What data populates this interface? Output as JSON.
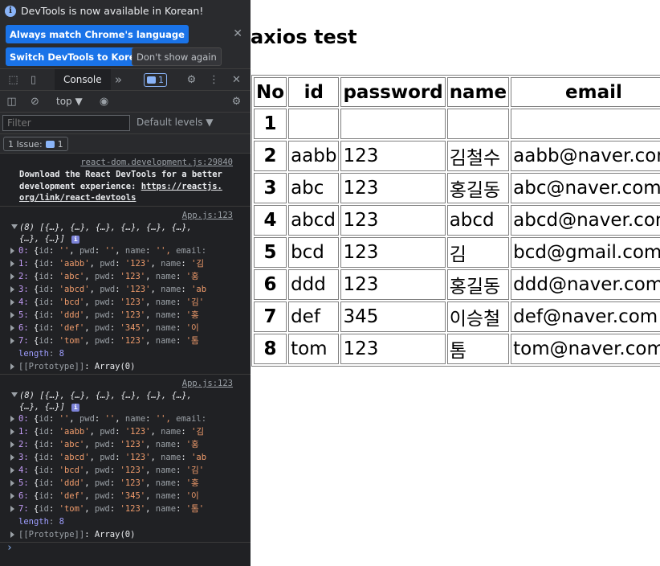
{
  "devtools": {
    "infobar": {
      "message": "DevTools is now available in Korean!",
      "btn_match": "Always match Chrome's language",
      "btn_switch": "Switch DevTools to Korean",
      "btn_dont": "Don't show again"
    },
    "tabs": {
      "console": "Console",
      "more": "»",
      "issues_count": "1"
    },
    "toolbar": {
      "context": "top ▼",
      "filter_placeholder": "Filter",
      "levels": "Default levels ▼",
      "issue_chip_label": "1 Issue:",
      "issue_chip_count": "1"
    },
    "log1": {
      "source": "react-dom.development.js:29840",
      "line1": "Download the React DevTools for a better",
      "line2_prefix": "development experience: ",
      "link_part1": "https://reactjs.",
      "link_part2": "org/link/react-devtools"
    },
    "log2": {
      "source": "App.js:123",
      "summary_1": "(8) [{…}, {…}, {…}, {…}, {…}, {…},",
      "summary_2": "{…}, {…}]",
      "rows": [
        {
          "idx": "0:",
          "id": "''",
          "pwd": "''",
          "name": "'',",
          "tail": "email:"
        },
        {
          "idx": "1:",
          "id": "'aabb'",
          "pwd": "'123'",
          "name": "'김"
        },
        {
          "idx": "2:",
          "id": "'abc'",
          "pwd": "'123'",
          "name": "'홍"
        },
        {
          "idx": "3:",
          "id": "'abcd'",
          "pwd": "'123'",
          "name": "'ab"
        },
        {
          "idx": "4:",
          "id": "'bcd'",
          "pwd": "'123'",
          "name": "'김'"
        },
        {
          "idx": "5:",
          "id": "'ddd'",
          "pwd": "'123'",
          "name": "'홍"
        },
        {
          "idx": "6:",
          "id": "'def'",
          "pwd": "'345'",
          "name": "'이"
        },
        {
          "idx": "7:",
          "id": "'tom'",
          "pwd": "'123'",
          "name": "'톰"
        }
      ],
      "length_key": "length",
      "length_val": "8",
      "proto": "[[Prototype]]",
      "proto_val": "Array(0)"
    },
    "log3": {
      "source": "App.js:123",
      "summary_1": "(8) [{…}, {…}, {…}, {…}, {…}, {…},",
      "summary_2": "{…}, {…}]",
      "rows": [
        {
          "idx": "0:",
          "id": "''",
          "pwd": "''",
          "name": "'',",
          "tail": "email:"
        },
        {
          "idx": "1:",
          "id": "'aabb'",
          "pwd": "'123'",
          "name": "'김"
        },
        {
          "idx": "2:",
          "id": "'abc'",
          "pwd": "'123'",
          "name": "'홍"
        },
        {
          "idx": "3:",
          "id": "'abcd'",
          "pwd": "'123'",
          "name": "'ab"
        },
        {
          "idx": "4:",
          "id": "'bcd'",
          "pwd": "'123'",
          "name": "'김'"
        },
        {
          "idx": "5:",
          "id": "'ddd'",
          "pwd": "'123'",
          "name": "'홍"
        },
        {
          "idx": "6:",
          "id": "'def'",
          "pwd": "'345'",
          "name": "'이"
        },
        {
          "idx": "7:",
          "id": "'tom'",
          "pwd": "'123'",
          "name": "'톰'"
        }
      ],
      "length_key": "length",
      "length_val": "8",
      "proto": "[[Prototype]]",
      "proto_val": "Array(0)"
    },
    "prompt": "›"
  },
  "page": {
    "title": "axios test",
    "table": {
      "headers": [
        "No",
        "id",
        "password",
        "name",
        "email"
      ],
      "rows": [
        [
          "1",
          "",
          "",
          "",
          ""
        ],
        [
          "2",
          "aabb",
          "123",
          "김철수",
          "aabb@naver.com"
        ],
        [
          "3",
          "abc",
          "123",
          "홍길동",
          "abc@naver.com"
        ],
        [
          "4",
          "abcd",
          "123",
          "abcd",
          "abcd@naver.com"
        ],
        [
          "5",
          "bcd",
          "123",
          "김",
          "bcd@gmail.com"
        ],
        [
          "6",
          "ddd",
          "123",
          "홍길동",
          "ddd@naver.com"
        ],
        [
          "7",
          "def",
          "345",
          "이승철",
          "def@naver.com"
        ],
        [
          "8",
          "tom",
          "123",
          "톰",
          "tom@naver.com"
        ]
      ]
    }
  }
}
